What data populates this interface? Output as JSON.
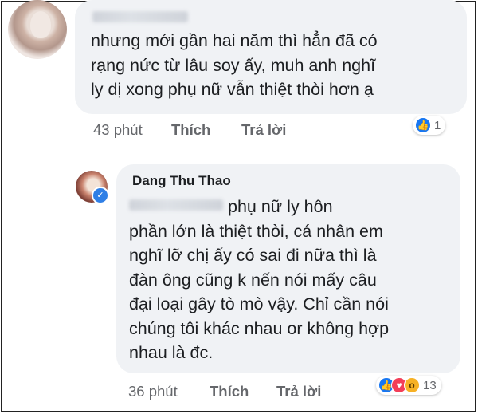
{
  "comments": [
    {
      "text_lines": [
        "nhưng mới gần hai năm thì hẳn đã có",
        "rạng nức từ lâu soy ấy, muh anh nghĩ",
        "ly dị xong phụ nữ vẫn thiệt thòi hơn ạ"
      ],
      "time": "43 phút",
      "like_label": "Thích",
      "reply_label": "Trả lời",
      "reaction_icons": [
        "like-icon"
      ],
      "reaction_count": "1"
    },
    {
      "author": "Dang Thu Thao",
      "first_line_after_mention": "phụ nữ ly hôn",
      "text_lines": [
        "phần lớn là thiệt thòi, cá nhân em",
        "nghĩ lỡ chị ấy có sai đi nữa thì là",
        "đàn ông cũng k nến nói mấy câu",
        "đại loại gây tò mò vậy. Chỉ cần nói",
        "chúng tôi khác nhau or không hợp",
        "nhau là đc."
      ],
      "time": "36 phút",
      "like_label": "Thích",
      "reply_label": "Trả lời",
      "reaction_icons": [
        "like-icon",
        "love-icon",
        "wow-icon"
      ],
      "reaction_count": "13"
    }
  ],
  "colors": {
    "bubble": "#f0f2f5",
    "text": "#1c1e21",
    "meta": "#65676b",
    "like": "#1877f2",
    "love": "#f33e58",
    "wow": "#f7b125"
  }
}
